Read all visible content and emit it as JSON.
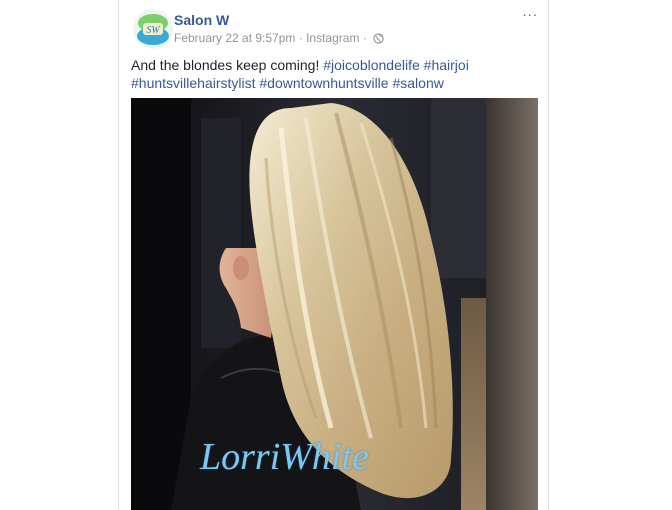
{
  "post": {
    "page_name": "Salon W",
    "timestamp": "February 22 at 9:57pm",
    "separator": " · ",
    "source": "Instagram",
    "separator2": " · ",
    "privacy_icon": "globe-icon",
    "more_icon": "more-options-icon",
    "more_glyph": "···",
    "text": "And the blondes keep coming!",
    "hashtags": [
      "#joicoblondelife",
      "#hairjoi",
      "#huntsvillehairstylist",
      "#downtownhuntsville",
      "#salonw"
    ],
    "watermark": "LorriWhite"
  },
  "colors": {
    "link": "#365899",
    "meta": "#90949c",
    "text": "#1d2129",
    "watermark": "#7ec8f0"
  }
}
